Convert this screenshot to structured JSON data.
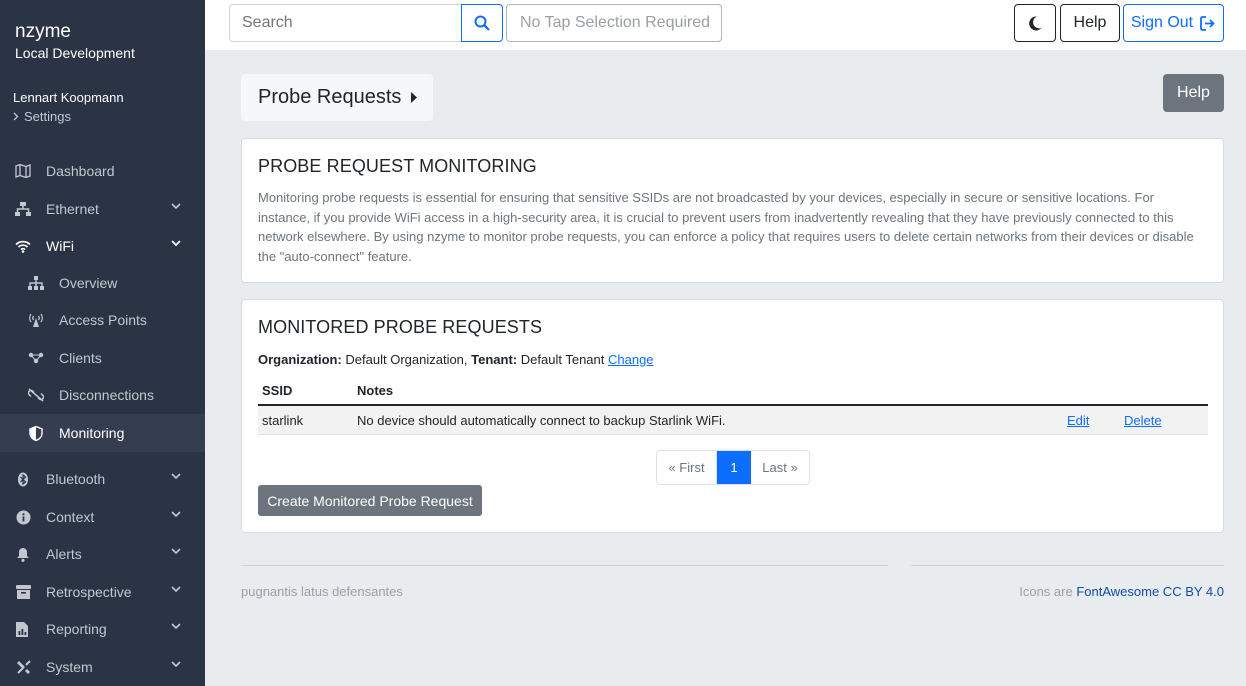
{
  "brand": {
    "name": "nzyme",
    "environment": "Local Development"
  },
  "user": {
    "name": "Lennart Koopmann",
    "settings_label": "Settings"
  },
  "nav": {
    "dashboard": "Dashboard",
    "ethernet": "Ethernet",
    "wifi": "WiFi",
    "wifi_overview": "Overview",
    "wifi_access_points": "Access Points",
    "wifi_clients": "Clients",
    "wifi_disconnections": "Disconnections",
    "wifi_monitoring": "Monitoring",
    "bluetooth": "Bluetooth",
    "context": "Context",
    "alerts": "Alerts",
    "retrospective": "Retrospective",
    "reporting": "Reporting",
    "system": "System"
  },
  "topbar": {
    "search_placeholder": "Search",
    "tap_selection": "No Tap Selection Required",
    "help_label": "Help",
    "signout_label": "Sign Out"
  },
  "page": {
    "breadcrumb": "Probe Requests",
    "help_label": "Help"
  },
  "monitoring_card": {
    "title": "PROBE REQUEST MONITORING",
    "description": "Monitoring probe requests is essential for ensuring that sensitive SSIDs are not broadcasted by your devices, especially in secure or sensitive locations. For instance, if you provide WiFi access in a high-security area, it is crucial to prevent users from inadvertently revealing that they have previously connected to this network elsewhere. By using nzyme to monitor probe requests, you can enforce a policy that requires users to delete certain networks from their devices or disable the \"auto-connect\" feature."
  },
  "monitored_card": {
    "title": "MONITORED PROBE REQUESTS",
    "org_label": "Organization:",
    "org_value": "Default Organization,",
    "tenant_label": "Tenant:",
    "tenant_value": "Default Tenant",
    "change_label": "Change",
    "columns": {
      "ssid": "SSID",
      "notes": "Notes"
    },
    "rows": [
      {
        "ssid": "starlink",
        "notes": "No device should automatically connect to backup Starlink WiFi.",
        "edit": "Edit",
        "delete": "Delete"
      }
    ],
    "pager": {
      "first": "« First",
      "current": "1",
      "last": "Last »"
    },
    "create_label": "Create Monitored Probe Request"
  },
  "footer": {
    "left": "pugnantis latus defensantes",
    "right_prefix": "Icons are",
    "right_link": "FontAwesome CC BY 4.0"
  },
  "colors": {
    "sidebar": "#2b3445",
    "primary": "#0d6efd",
    "secondary": "#6c757d",
    "background": "#e9ecef"
  }
}
